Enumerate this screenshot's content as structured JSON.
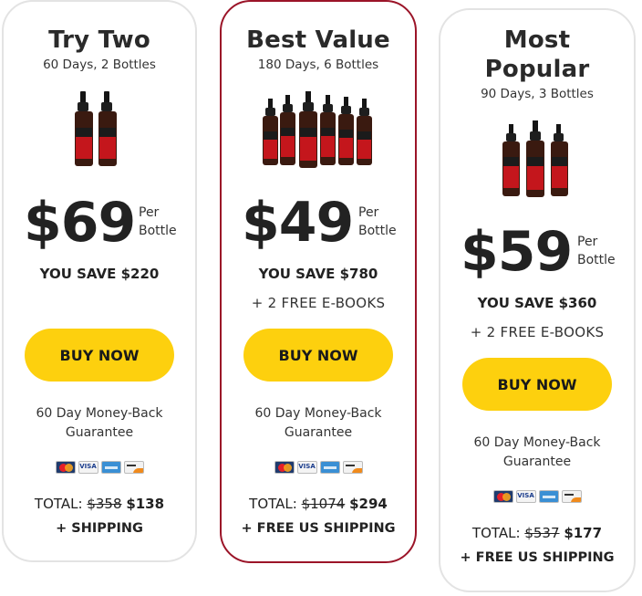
{
  "cards": [
    {
      "title": "Try Two",
      "subtitle": "60 Days, 2 Bottles",
      "bottle_count": 2,
      "price": "$69",
      "per_line1": "Per",
      "per_line2": "Bottle",
      "save": "YOU SAVE $220",
      "bonus": "",
      "buy_label": "BUY NOW",
      "guarantee_line1": "60 Day Money-Back",
      "guarantee_line2": "Guarantee",
      "total_label": "TOTAL:",
      "total_old": "$358",
      "total_new": "$138",
      "shipping": "+ SHIPPING",
      "highlighted": false
    },
    {
      "title": "Best Value",
      "subtitle": "180 Days, 6 Bottles",
      "bottle_count": 6,
      "price": "$49",
      "per_line1": "Per",
      "per_line2": "Bottle",
      "save": "YOU SAVE $780",
      "bonus": "+ 2 FREE E-BOOKS",
      "buy_label": "BUY NOW",
      "guarantee_line1": "60 Day Money-Back",
      "guarantee_line2": "Guarantee",
      "total_label": "TOTAL:",
      "total_old": "$1074",
      "total_new": "$294",
      "shipping": "+ FREE US SHIPPING",
      "highlighted": true
    },
    {
      "title_line1": "Most",
      "title_line2": "Popular",
      "subtitle": "90 Days, 3 Bottles",
      "bottle_count": 3,
      "price": "$59",
      "per_line1": "Per",
      "per_line2": "Bottle",
      "save": "YOU SAVE $360",
      "bonus": "+ 2 FREE E-BOOKS",
      "buy_label": "BUY NOW",
      "guarantee_line1": "60 Day Money-Back",
      "guarantee_line2": "Guarantee",
      "total_label": "TOTAL:",
      "total_old": "$537",
      "total_new": "$177",
      "shipping": "+ FREE US SHIPPING",
      "highlighted": false
    }
  ],
  "payment_icons": [
    "mastercard-icon",
    "visa-icon",
    "amex-icon",
    "discover-icon"
  ],
  "colors": {
    "button": "#fdd00e",
    "highlight_border": "#9b1428",
    "card_border": "#e3e3e3",
    "bottle_body": "#3a1a10",
    "bottle_label": "#c4161c"
  }
}
